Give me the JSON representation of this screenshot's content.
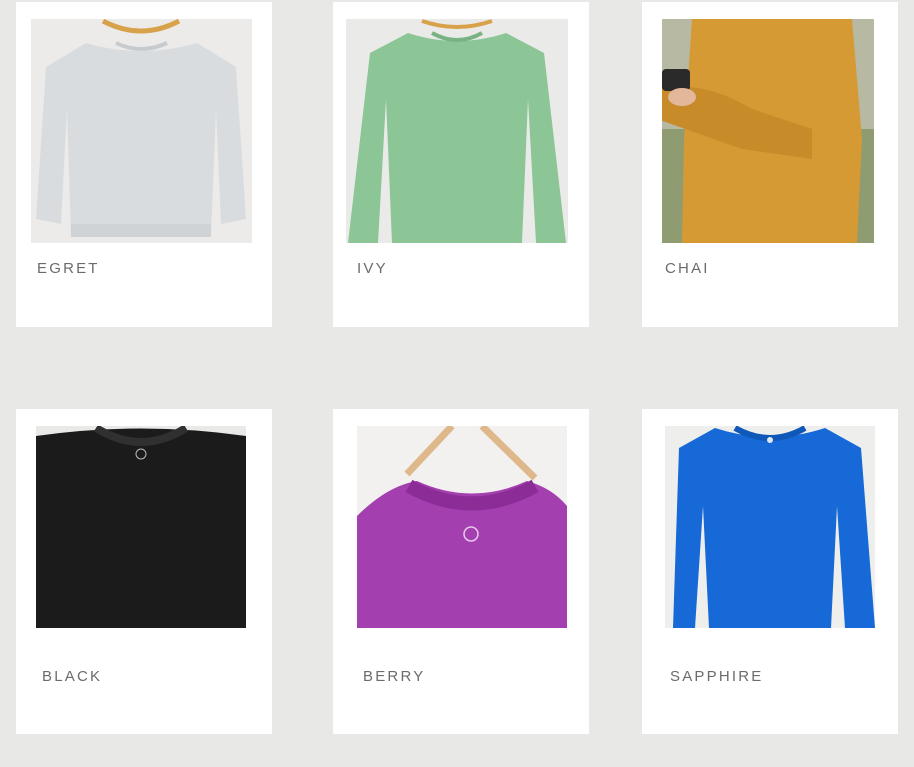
{
  "products": [
    {
      "name": "EGRET",
      "color": "#d9dcde",
      "bg": "#ecebea",
      "photo_icon": "sweatshirt-on-hanger"
    },
    {
      "name": "IVY",
      "color": "#8cc596",
      "bg": "#eaeae8",
      "photo_icon": "sweatshirt-on-hanger"
    },
    {
      "name": "CHAI",
      "color": "#d59a33",
      "bg": "#8f9b70",
      "photo_icon": "person-wearing-sweatshirt"
    },
    {
      "name": "BLACK",
      "color": "#1b1b1b",
      "bg": "#e9e9e7",
      "photo_icon": "sweatshirt-closeup"
    },
    {
      "name": "BERRY",
      "color": "#a43fb0",
      "bg": "#f2f1ef",
      "photo_icon": "sweatshirt-on-hanger-closeup"
    },
    {
      "name": "SAPPHIRE",
      "color": "#1669d6",
      "bg": "#eeeeec",
      "photo_icon": "sweatshirt-on-hanger"
    }
  ]
}
